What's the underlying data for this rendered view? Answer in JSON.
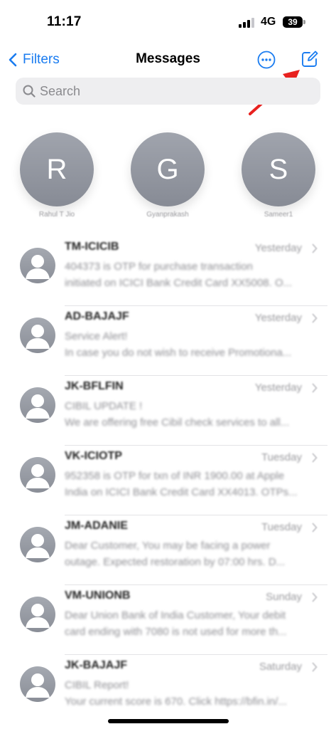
{
  "status_bar": {
    "time": "11:17",
    "network": "4G",
    "battery": "39"
  },
  "nav": {
    "back_label": "Filters",
    "title": "Messages",
    "more_icon": "ellipsis-circle-icon",
    "compose_icon": "compose-icon",
    "accent_color": "#1a7cf0"
  },
  "search": {
    "placeholder": "Search"
  },
  "annotation": {
    "color": "#e8211f"
  },
  "pinned": [
    {
      "initial": "R",
      "name": "Rahul T Jio"
    },
    {
      "initial": "G",
      "name": "Gyanprakash"
    },
    {
      "initial": "S",
      "name": "Sameer1"
    }
  ],
  "messages": [
    {
      "sender": "TM-ICICIB",
      "date": "Yesterday",
      "line1": "404373 is OTP for purchase transaction",
      "line2": "initiated on ICICI Bank Credit Card XX5008. O..."
    },
    {
      "sender": "AD-BAJAJF",
      "date": "Yesterday",
      "line1": "Service Alert!",
      "line2": "In case you do not wish to receive Promotiona..."
    },
    {
      "sender": "JK-BFLFIN",
      "date": "Yesterday",
      "line1": "CIBIL UPDATE !",
      "line2": "We are offering free Cibil check services to all..."
    },
    {
      "sender": "VK-ICIOTP",
      "date": "Tuesday",
      "line1": "952358 is OTP for txn of INR 1900.00 at Apple",
      "line2": "India on ICICI Bank Credit Card XX4013. OTPs..."
    },
    {
      "sender": "JM-ADANIE",
      "date": "Tuesday",
      "line1": "Dear Customer, You may be facing a power",
      "line2": "outage. Expected restoration by 07:00 hrs. D..."
    },
    {
      "sender": "VM-UNIONB",
      "date": "Sunday",
      "line1": "Dear Union Bank of India Customer, Your debit",
      "line2": "card ending with 7080 is not used for more th..."
    },
    {
      "sender": "JK-BAJAJF",
      "date": "Saturday",
      "line1": "CIBIL Report!",
      "line2": "Your current score is 670. Click https://bfin.in/..."
    }
  ]
}
